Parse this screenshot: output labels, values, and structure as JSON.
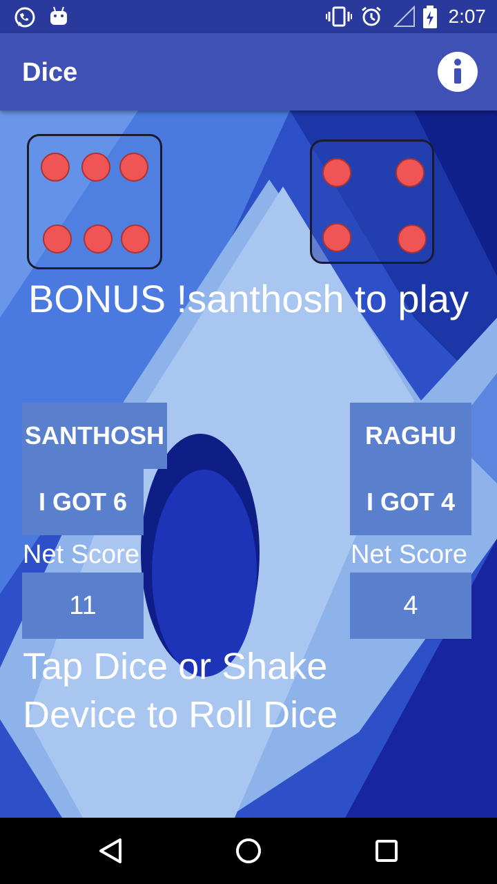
{
  "status_bar": {
    "time": "2:07",
    "icons": [
      "whatsapp-icon",
      "android-icon",
      "vibrate-icon",
      "alarm-icon",
      "signal-icon",
      "battery-charging-icon"
    ]
  },
  "app_bar": {
    "title": "Dice",
    "info_icon": "info-icon"
  },
  "dice": [
    {
      "value": 6
    },
    {
      "value": 4
    }
  ],
  "message": "BONUS !santhosh to play",
  "players": [
    {
      "name": "SANTHOSH",
      "roll_text": "I GOT 6",
      "net_score_label": "Net Score",
      "net_score": "11"
    },
    {
      "name": "RAGHU",
      "roll_text": "I GOT 4",
      "net_score_label": "Net Score",
      "net_score": "4"
    }
  ],
  "instructions": "Tap Dice or Shake Device to Roll Dice",
  "nav_bar": {
    "buttons": [
      "back-icon",
      "home-icon",
      "recents-icon"
    ]
  },
  "colors": {
    "app_bar": "#3f51b5",
    "status_bar": "#2a3a9c",
    "pip": "#f05555",
    "score_box": "#5a7fcc"
  }
}
